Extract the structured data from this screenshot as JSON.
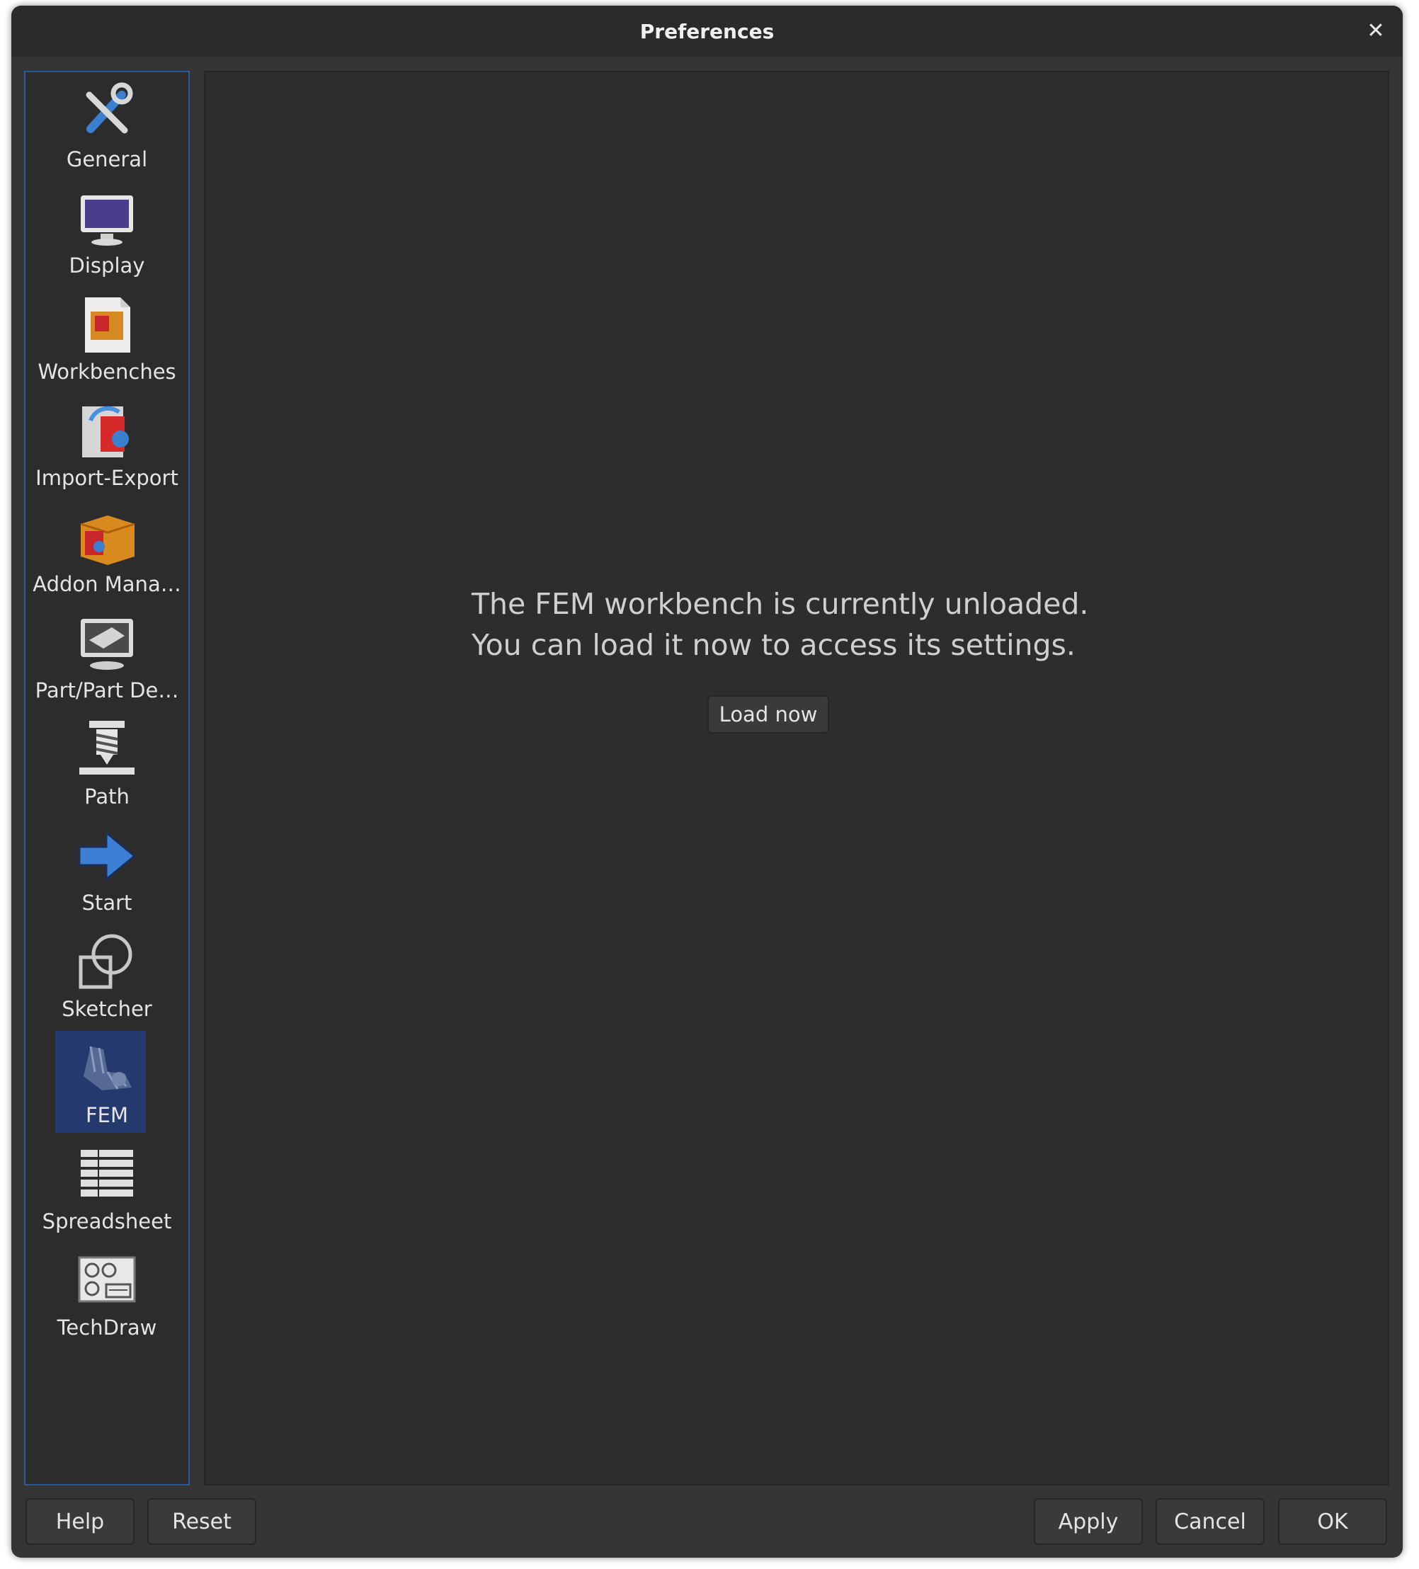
{
  "window": {
    "title": "Preferences"
  },
  "sidebar": {
    "items": [
      {
        "label": "General",
        "icon": "tools-icon"
      },
      {
        "label": "Display",
        "icon": "monitor-icon"
      },
      {
        "label": "Workbenches",
        "icon": "workbench-box-icon"
      },
      {
        "label": "Import-Export",
        "icon": "import-export-icon"
      },
      {
        "label": "Addon Mana…",
        "icon": "addon-box-icon"
      },
      {
        "label": "Part/Part De…",
        "icon": "part-design-icon"
      },
      {
        "label": "Path",
        "icon": "path-mill-icon"
      },
      {
        "label": "Start",
        "icon": "arrow-right-icon"
      },
      {
        "label": "Sketcher",
        "icon": "sketcher-icon"
      },
      {
        "label": "FEM",
        "icon": "fem-icon",
        "selected": true
      },
      {
        "label": "Spreadsheet",
        "icon": "spreadsheet-icon"
      },
      {
        "label": "TechDraw",
        "icon": "techdraw-icon"
      }
    ]
  },
  "content": {
    "message_line1": "The FEM workbench is currently unloaded.",
    "message_line2": "You can load it now to access its settings.",
    "load_button": "Load now"
  },
  "footer": {
    "help": "Help",
    "reset": "Reset",
    "apply": "Apply",
    "cancel": "Cancel",
    "ok": "OK"
  },
  "colors": {
    "selection": "#243a6e",
    "sidebar_border": "#2a5a9e",
    "window_bg": "#353535"
  }
}
